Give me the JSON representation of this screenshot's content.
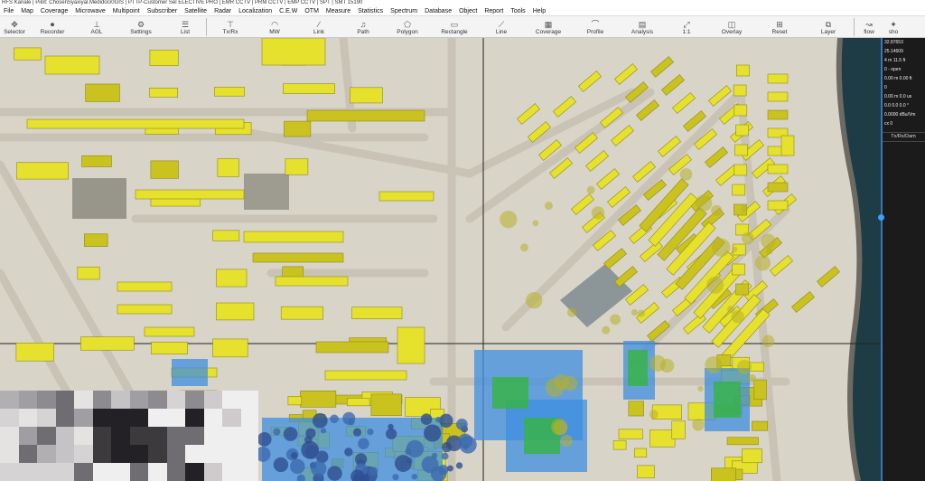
{
  "window": {
    "title": "RFS Kanale | Pilot: ChosenSyaxiyal.MedidoG0GIS | PTTP-Customer Sel ELECTIVE PRO | EMR CCTV | PRM CCTV | EMP CCTV | SPT | SMT 15190"
  },
  "menu": [
    "File",
    "Map",
    "Coverage",
    "Microwave",
    "Multipoint",
    "Subscriber",
    "Satellite",
    "Radar",
    "Localization",
    "C.E.W",
    "OTM",
    "Measure",
    "Statistics",
    "Spectrum",
    "Database",
    "Object",
    "Report",
    "Tools",
    "Help"
  ],
  "toolbar": [
    {
      "label": "Selector",
      "icon": "move-icon",
      "glyph": "✥"
    },
    {
      "label": "Recorder",
      "icon": "record-icon",
      "glyph": "⏺"
    },
    {
      "label": "AGL",
      "icon": "agl-icon",
      "glyph": "⊥"
    },
    {
      "label": "Settings",
      "icon": "gear-icon",
      "glyph": "⚙"
    },
    {
      "label": "List",
      "icon": "list-icon",
      "glyph": "☰"
    },
    {
      "label": "Tx/Rx",
      "icon": "antenna-icon",
      "glyph": "⊤"
    },
    {
      "label": "MW",
      "icon": "microwave-icon",
      "glyph": "◠"
    },
    {
      "label": "Link",
      "icon": "link-icon",
      "glyph": "∕"
    },
    {
      "label": "Path",
      "icon": "path-icon",
      "glyph": "♫"
    },
    {
      "label": "Polygon",
      "icon": "polygon-icon",
      "glyph": "⬠"
    },
    {
      "label": "Rectangle",
      "icon": "rectangle-icon",
      "glyph": "▭"
    },
    {
      "label": "Line",
      "icon": "line-icon",
      "glyph": "⟋"
    },
    {
      "label": "Coverage",
      "icon": "coverage-icon",
      "glyph": "▦"
    },
    {
      "label": "Profile",
      "icon": "profile-icon",
      "glyph": "⌒"
    },
    {
      "label": "Analysis",
      "icon": "analysis-icon",
      "glyph": "▤"
    },
    {
      "label": "1:1",
      "icon": "fit-icon",
      "glyph": "⤢"
    },
    {
      "label": "Overlay",
      "icon": "overlay-icon",
      "glyph": "◫"
    },
    {
      "label": "Reset",
      "icon": "reset-icon",
      "glyph": "⊞"
    },
    {
      "label": "Layer",
      "icon": "layer-icon",
      "glyph": "⧉"
    },
    {
      "label": "flow",
      "icon": "flow-icon",
      "glyph": "↝"
    },
    {
      "label": "sho",
      "icon": "show-icon",
      "glyph": "✦"
    }
  ],
  "readout": [
    "32.87653",
    "25.14609",
    "4 m  11.5 ft",
    "0 - open",
    "0.00 m  0.00 ft",
    "0",
    "0.00 m  0.0 us",
    "0.0 0.0 0.0 °",
    "0.0000 dBu/Vm",
    "cx 0"
  ],
  "readout_header": "Tx/Rx/Dam",
  "colors": {
    "building": "#e6e12c",
    "building_dark": "#c9c21f",
    "signal_blue": "#3f8fe0",
    "signal_green": "#37b34a",
    "sea": "#1d3c46",
    "ground": "#d9d4c8",
    "road": "#c9c3b6"
  }
}
